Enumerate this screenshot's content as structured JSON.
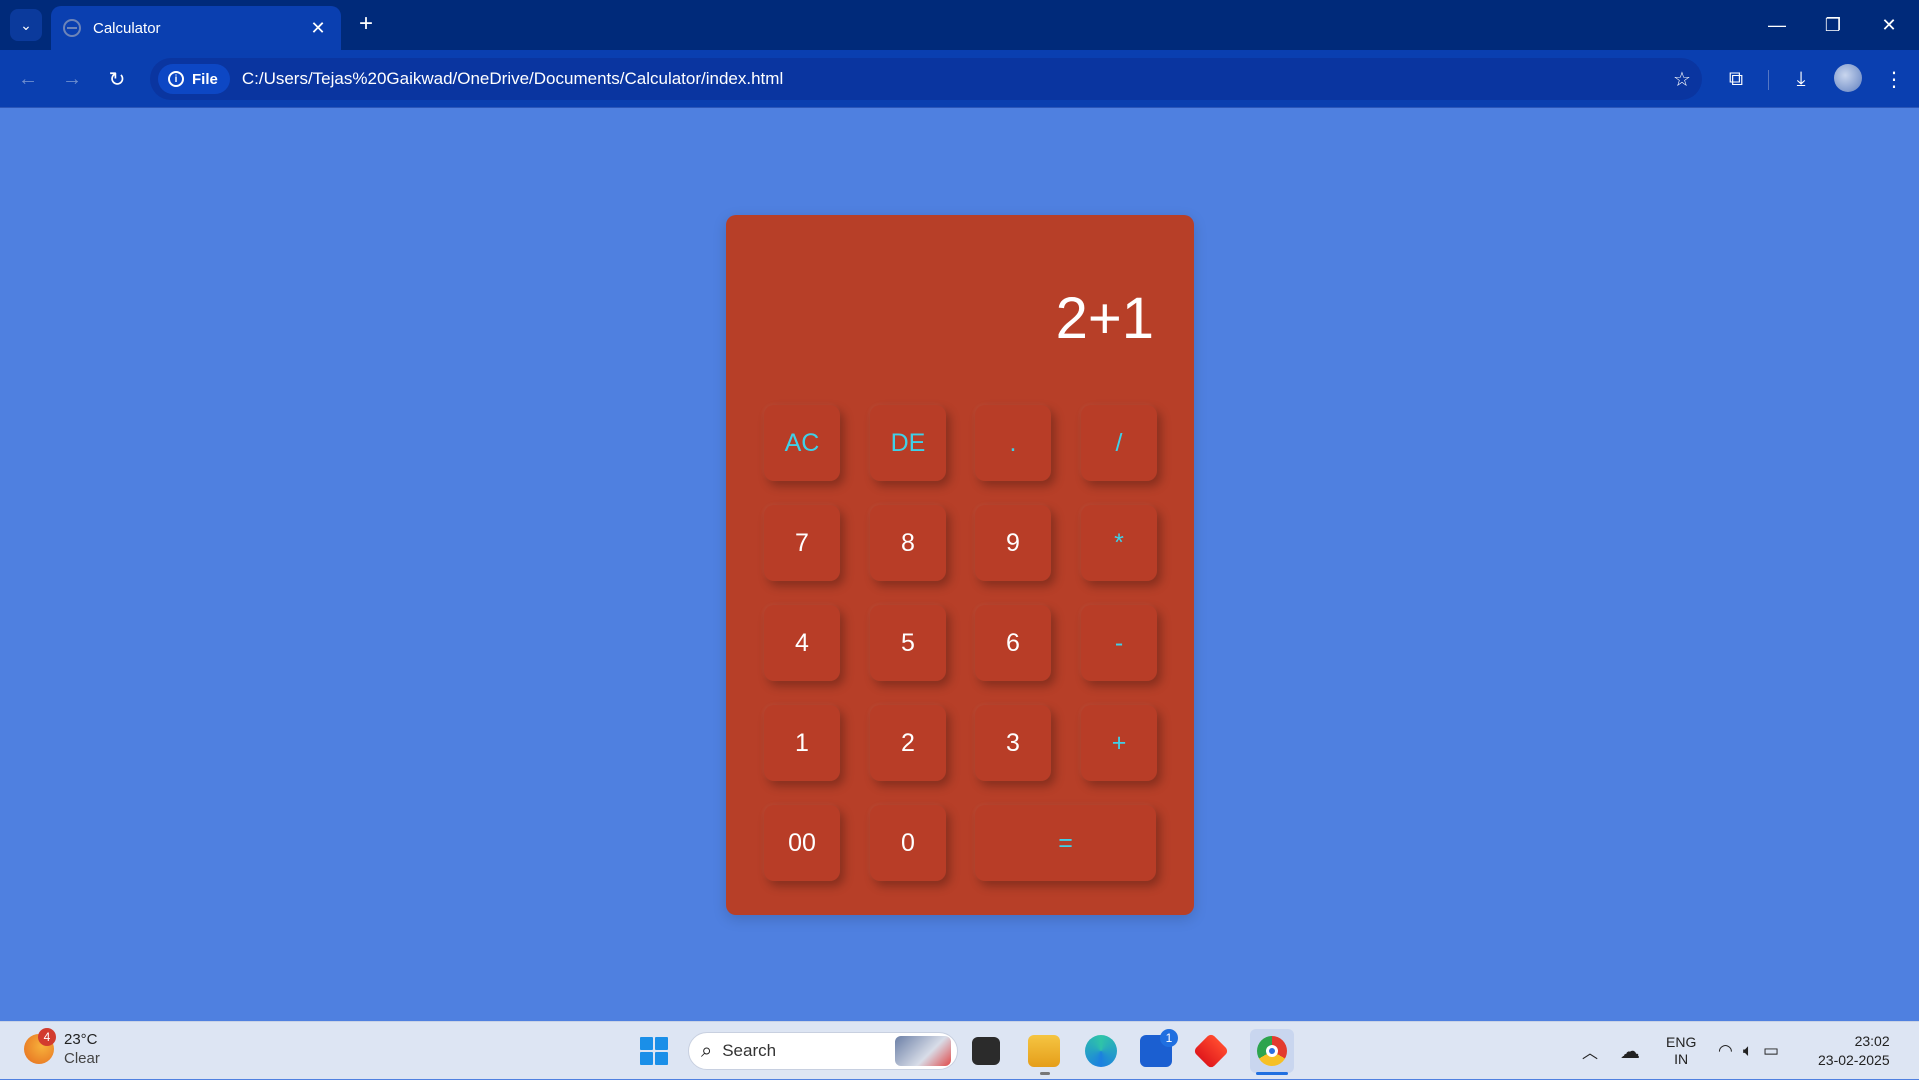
{
  "browser": {
    "tab_title": "Calculator",
    "tab_close": "✕",
    "new_tab": "+",
    "site_chip_label": "File",
    "url": "C:/Users/Tejas%20Gaikwad/OneDrive/Documents/Calculator/index.html"
  },
  "calculator": {
    "display": "2+1",
    "keys": [
      {
        "label": "AC",
        "type": "op"
      },
      {
        "label": "DE",
        "type": "op"
      },
      {
        "label": ".",
        "type": "op"
      },
      {
        "label": "/",
        "type": "op"
      },
      {
        "label": "7",
        "type": "num"
      },
      {
        "label": "8",
        "type": "num"
      },
      {
        "label": "9",
        "type": "num"
      },
      {
        "label": "*",
        "type": "op"
      },
      {
        "label": "4",
        "type": "num"
      },
      {
        "label": "5",
        "type": "num"
      },
      {
        "label": "6",
        "type": "num"
      },
      {
        "label": "-",
        "type": "op"
      },
      {
        "label": "1",
        "type": "num"
      },
      {
        "label": "2",
        "type": "num"
      },
      {
        "label": "3",
        "type": "num"
      },
      {
        "label": "+",
        "type": "op"
      },
      {
        "label": "00",
        "type": "num"
      },
      {
        "label": "0",
        "type": "num"
      },
      {
        "label": "=",
        "type": "op"
      }
    ]
  },
  "taskbar": {
    "weather_badge": "4",
    "weather_temp": "23°C",
    "weather_condition": "Clear",
    "search_label": "Search",
    "store_badge": "1",
    "lang_line1": "ENG",
    "lang_line2": "IN",
    "time": "23:02",
    "date": "23-02-2025"
  },
  "colors": {
    "page_background": "#4f80e0",
    "calculator_body": "#b73f28",
    "operator_text": "#3fd0e8",
    "browser_frame": "#002a7a"
  }
}
